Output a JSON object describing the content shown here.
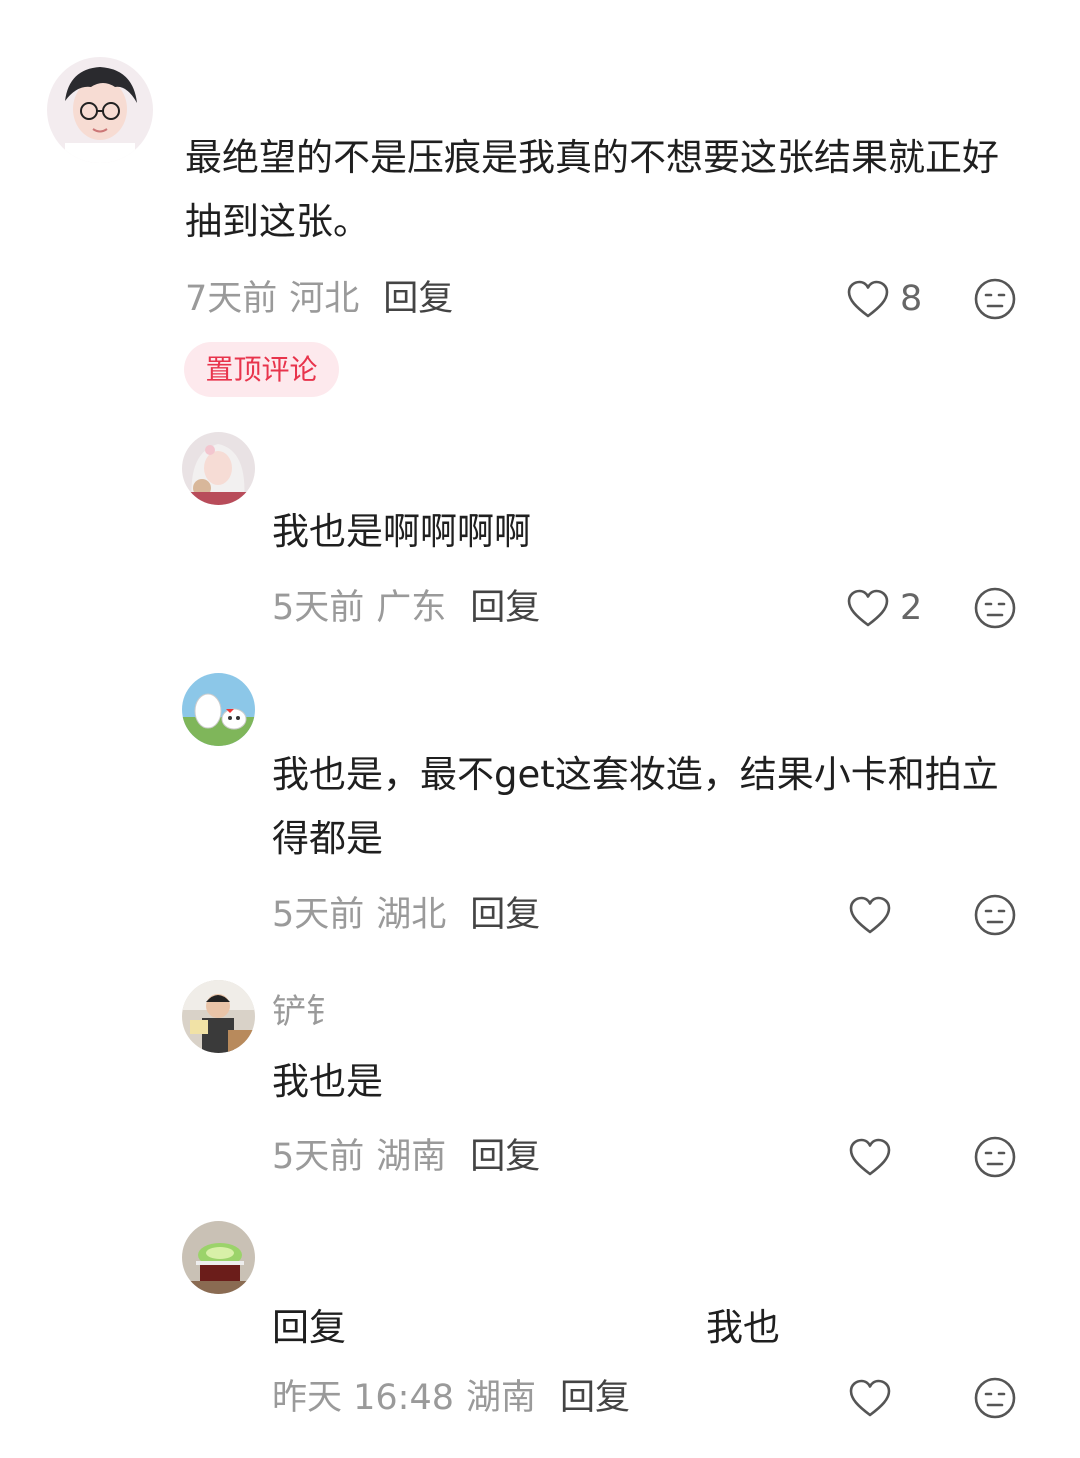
{
  "comments": [
    {
      "username": "",
      "text": "最绝望的不是压痕是我真的不想要这张结果就正好抽到这张。",
      "time": "7天前",
      "location": "河北",
      "reply_label": "回复",
      "likes": "8",
      "badge": "置顶评论"
    }
  ],
  "replies": [
    {
      "username": "",
      "text": "我也是啊啊啊啊",
      "time": "5天前",
      "location": "广东",
      "reply_label": "回复",
      "likes": "2"
    },
    {
      "username": "",
      "text": "我也是，最不get这套妆造，结果小卡和拍立得都是",
      "time": "5天前",
      "location": "湖北",
      "reply_label": "回复",
      "likes": ""
    },
    {
      "username": "铲钅",
      "text": "我也是",
      "time": "5天前",
      "location": "湖南",
      "reply_label": "回复",
      "likes": ""
    },
    {
      "username": "",
      "text_prefix": "回复",
      "text": "我也",
      "time": "昨天 16:48",
      "location": "湖南",
      "reply_label": "回复",
      "likes": ""
    }
  ],
  "icons": {
    "like": "heart-outline-icon",
    "dislike": "neutral-face-icon"
  },
  "colors": {
    "badge_text": "#e8344c",
    "badge_bg": "#fde9ed",
    "meta_gray": "#9a9a9a",
    "text": "#1f1f1f"
  }
}
